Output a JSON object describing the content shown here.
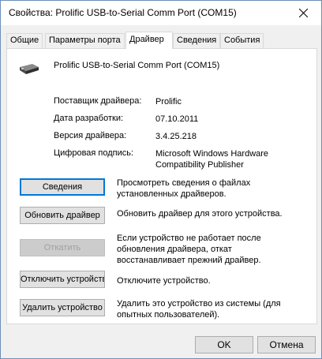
{
  "window": {
    "title": "Свойства: Prolific USB-to-Serial Comm Port (COM15)"
  },
  "tabs": [
    {
      "label": "Общие"
    },
    {
      "label": "Параметры порта"
    },
    {
      "label": "Драйвер",
      "active": true
    },
    {
      "label": "Сведения"
    },
    {
      "label": "События"
    }
  ],
  "device": {
    "name": "Prolific USB-to-Serial Comm Port (COM15)",
    "icon": "usb-serial-device-icon"
  },
  "properties": {
    "provider_label": "Поставщик драйвера:",
    "provider_value": "Prolific",
    "date_label": "Дата разработки:",
    "date_value": "07.10.2011",
    "version_label": "Версия драйвера:",
    "version_value": "3.4.25.218",
    "signature_label": "Цифровая подпись:",
    "signature_value_line1": "Microsoft Windows Hardware",
    "signature_value_line2": "Compatibility Publisher"
  },
  "actions": {
    "details_label": "Сведения",
    "details_desc_line1": "Просмотреть сведения о файлах",
    "details_desc_line2": "установленных драйверов.",
    "update_label": "Обновить драйвер",
    "update_desc": "Обновить драйвер для этого устройства.",
    "rollback_label": "Откатить",
    "rollback_desc_line1": "Если устройство не работает после",
    "rollback_desc_line2": "обновления драйвера, откат",
    "rollback_desc_line3": "восстанавливает прежний драйвер.",
    "disable_label": "Отключить устройство",
    "disable_desc": "Отключите устройство.",
    "uninstall_label": "Удалить устройство",
    "uninstall_desc_line1": "Удалить это устройство из системы (для",
    "uninstall_desc_line2": "опытных пользователей)."
  },
  "footer": {
    "ok_label": "OK",
    "cancel_label": "Отмена"
  },
  "colors": {
    "window_border": "#6b8fb9",
    "focus_blue": "#0078d7",
    "button_face": "#e1e1e1"
  }
}
